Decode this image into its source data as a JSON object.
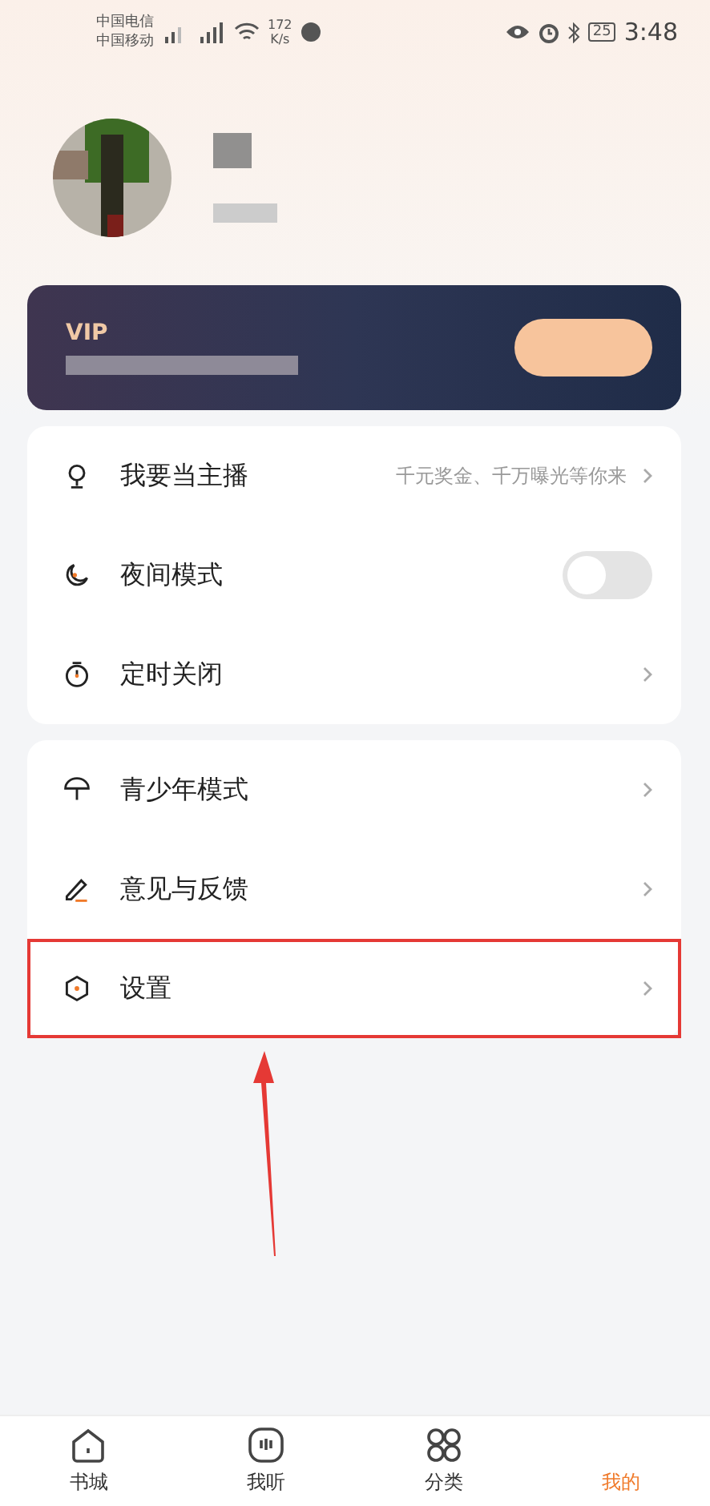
{
  "status_bar": {
    "carriers": [
      "中国电信",
      "中国移动"
    ],
    "speed": "172",
    "speed_unit": "K/s",
    "battery": "25",
    "time": "3:48"
  },
  "vip_card": {
    "title": "VIP"
  },
  "menu_groups": [
    {
      "items": [
        {
          "kind": "link",
          "label": "我要当主播",
          "hint": "千元奖金、千万曝光等你来",
          "highlighted": false
        },
        {
          "kind": "toggle",
          "label": "夜间模式",
          "on": false,
          "highlighted": false
        },
        {
          "kind": "link",
          "label": "定时关闭",
          "highlighted": false
        }
      ]
    },
    {
      "items": [
        {
          "kind": "link",
          "label": "青少年模式",
          "highlighted": false
        },
        {
          "kind": "link",
          "label": "意见与反馈",
          "highlighted": false
        },
        {
          "kind": "link",
          "label": "设置",
          "highlighted": true
        }
      ]
    }
  ],
  "bottom_nav": [
    {
      "label": "书城",
      "selected": false
    },
    {
      "label": "我听",
      "selected": false
    },
    {
      "label": "分类",
      "selected": false
    },
    {
      "label": "我的",
      "selected": true
    }
  ]
}
